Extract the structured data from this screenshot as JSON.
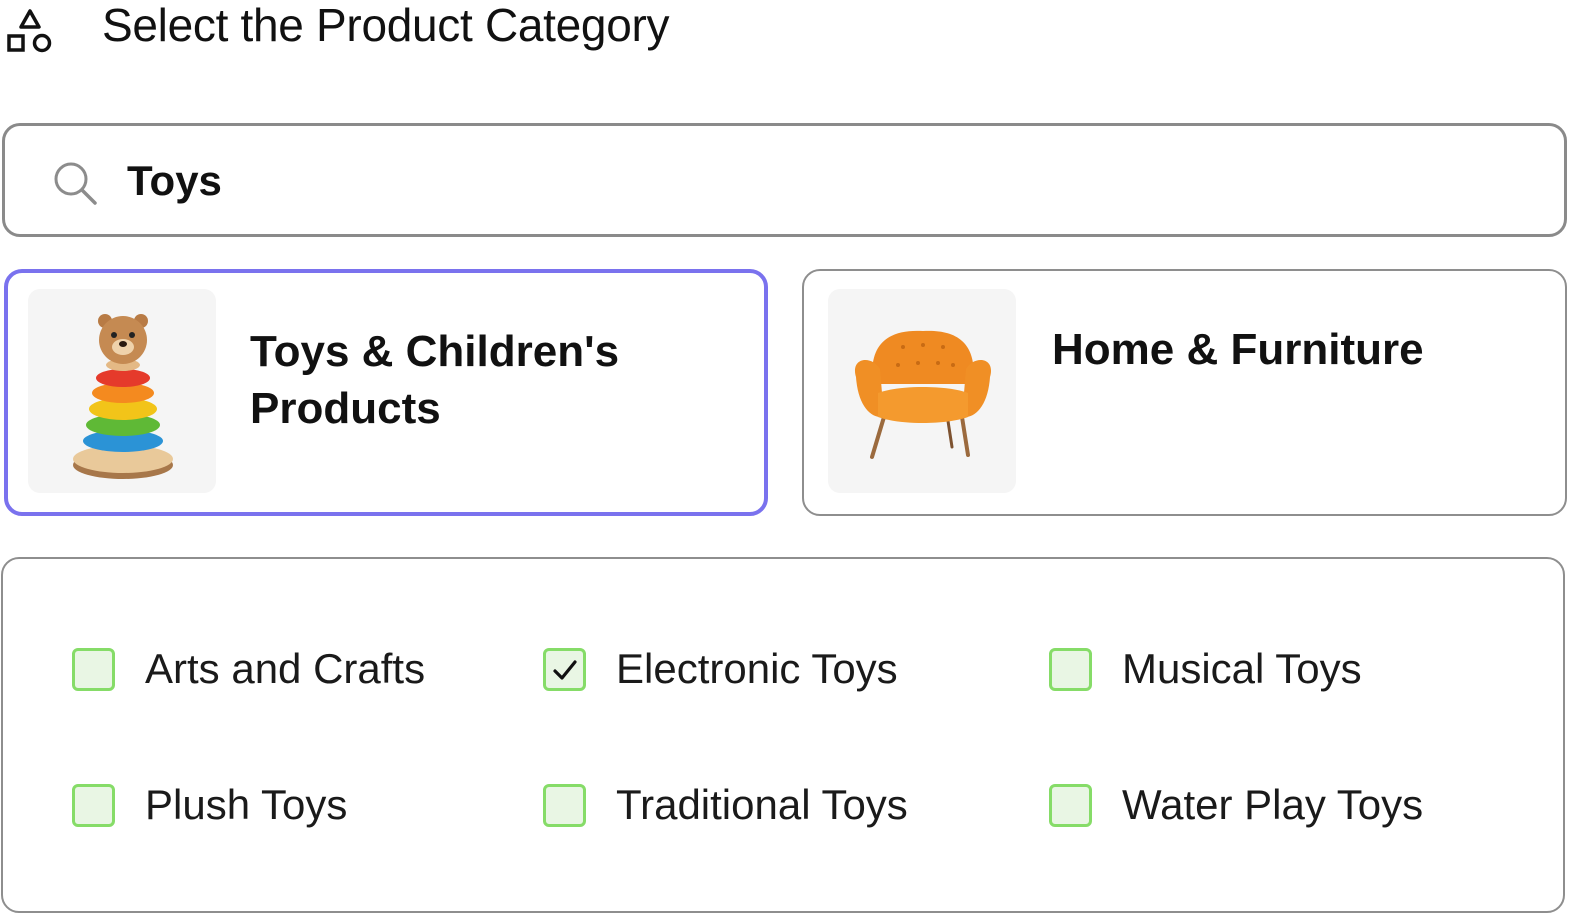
{
  "header": {
    "title": "Select the Product Category",
    "icon": "shapes-icon"
  },
  "search": {
    "value": "Toys",
    "icon": "search-icon"
  },
  "categories": [
    {
      "label": "Toys & Children's Products",
      "image": "stacking-toy-image",
      "selected": true
    },
    {
      "label": "Home & Furniture",
      "image": "armchair-image",
      "selected": false
    }
  ],
  "subcategories": [
    {
      "label": "Arts and Crafts",
      "checked": false
    },
    {
      "label": "Electronic Toys",
      "checked": true
    },
    {
      "label": "Musical Toys",
      "checked": false
    },
    {
      "label": "Plush Toys",
      "checked": false
    },
    {
      "label": "Traditional Toys",
      "checked": false
    },
    {
      "label": "Water Play Toys",
      "checked": false
    }
  ],
  "colors": {
    "selected_border": "#7a72ee",
    "checkbox_border": "#86dc68",
    "checkbox_fill": "#e9f6e4",
    "input_border": "#8a8a8a"
  }
}
